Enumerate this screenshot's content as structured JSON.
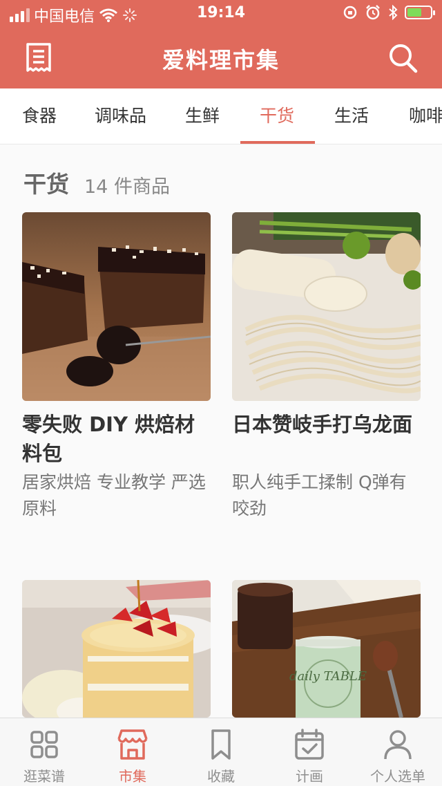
{
  "status_bar": {
    "carrier": "中国电信",
    "time": "19:14"
  },
  "nav": {
    "title": "爱料理市集",
    "menu_icon": "receipt-list-icon",
    "search_icon": "search-icon"
  },
  "tabs": [
    {
      "label": "食器"
    },
    {
      "label": "调味品"
    },
    {
      "label": "生鲜"
    },
    {
      "label": "干货"
    },
    {
      "label": "生活"
    },
    {
      "label": "咖啡"
    }
  ],
  "active_tab": "干货",
  "section": {
    "title": "干货",
    "count": "14 件商品"
  },
  "products": [
    {
      "title": "零失败 DIY 烘焙材料包",
      "subtitle": "居家烘焙 专业教学 严选原料"
    },
    {
      "title": "日本赞岐手打乌龙面",
      "subtitle": "职人纯手工揉制 Q弹有咬劲"
    },
    {
      "title": "",
      "subtitle": ""
    },
    {
      "title": "",
      "subtitle": ""
    }
  ],
  "product_images": {
    "product_4_label": "daily TABLE"
  },
  "tabbar": [
    {
      "label": "逛菜谱",
      "icon": "grid-icon"
    },
    {
      "label": "市集",
      "icon": "shop-icon"
    },
    {
      "label": "收藏",
      "icon": "bookmark-icon"
    },
    {
      "label": "计画",
      "icon": "calendar-check-icon"
    },
    {
      "label": "个人选单",
      "icon": "person-icon"
    }
  ],
  "colors": {
    "brand": "#e06a5c",
    "inactive": "#8e8e8e",
    "background": "#fafafa"
  }
}
